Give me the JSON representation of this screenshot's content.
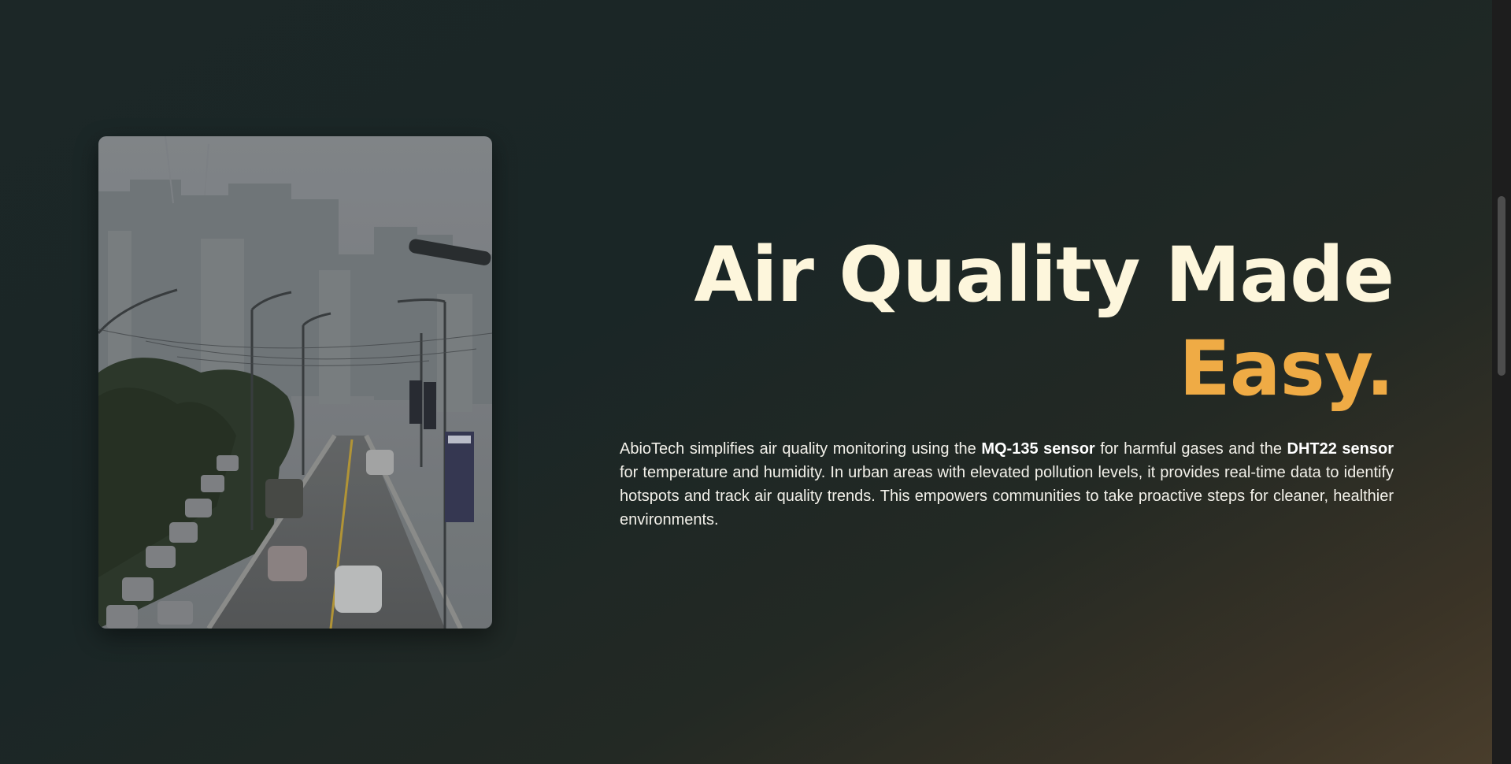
{
  "hero": {
    "image_alt": "Hazy city highway with traffic and high-rise buildings",
    "title_line1": "Air Quality Made",
    "title_line2": "Easy.",
    "description": {
      "part1": "AbioTech simplifies air quality monitoring using the ",
      "sensor1": "MQ-135 sensor",
      "part2": " for harmful gases and the ",
      "sensor2": "DHT22 sensor",
      "part3": " for temperature and humidity. In urban areas with elevated pollution levels, it provides real-time data to identify hotspots and track air quality trends. This empowers communities to take proactive steps for cleaner, healthier environments."
    }
  },
  "colors": {
    "title": "#fdf6dc",
    "accent": "#efab45",
    "background_start": "#1c2727",
    "background_end": "#4a3e2c"
  }
}
